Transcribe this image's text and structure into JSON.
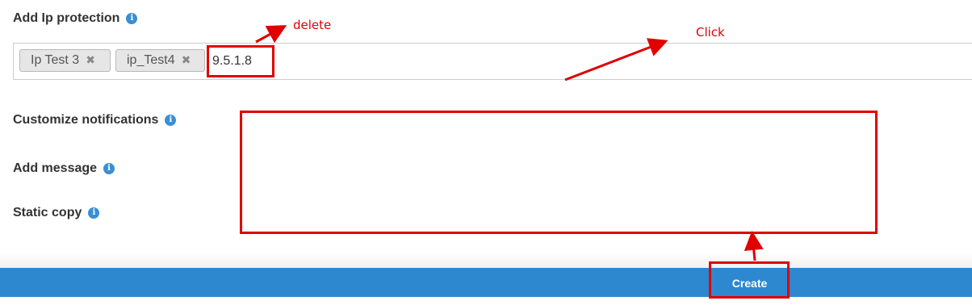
{
  "form": {
    "ip_protection": {
      "label": "Add Ip protection",
      "info_icon": "info-icon",
      "tags": [
        {
          "label": "Ip Test 3",
          "remove_glyph": "✖"
        },
        {
          "label": "ip_Test4",
          "remove_glyph": "✖"
        }
      ],
      "input_value": "9.5.1.8"
    },
    "customize_notifications": {
      "label": "Customize notifications",
      "info_icon": "info-icon"
    },
    "add_message": {
      "label": "Add message",
      "info_icon": "info-icon"
    },
    "static_copy": {
      "label": "Static copy",
      "info_icon": "info-icon"
    }
  },
  "footer": {
    "create_label": "Create",
    "bar_color": "#2d88d0"
  },
  "annotations": {
    "delete_label": "delete",
    "click_label": "Click",
    "color": "#e00000"
  }
}
